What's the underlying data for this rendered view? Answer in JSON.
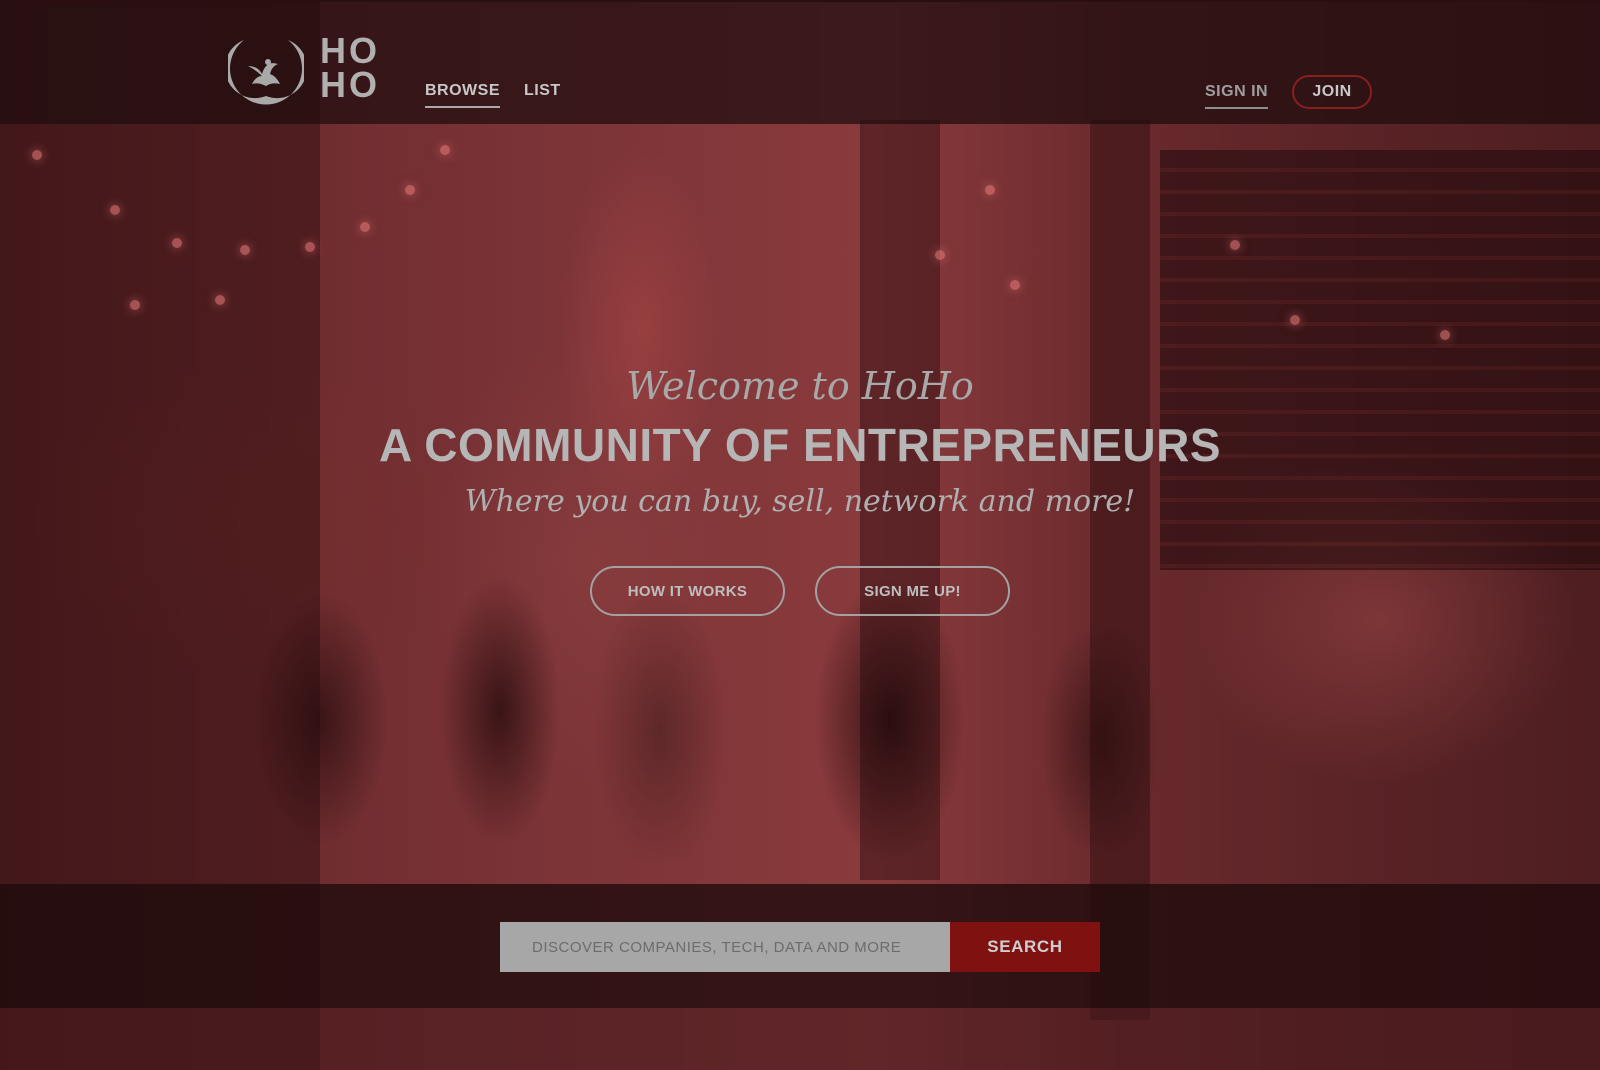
{
  "brand": {
    "logo_line1": "HO",
    "logo_line2": "HO",
    "logo_icon": "phoenix-icon"
  },
  "nav": {
    "items": [
      {
        "label": "BROWSE",
        "active": true
      },
      {
        "label": "LIST",
        "active": false
      }
    ]
  },
  "auth": {
    "signin_label": "SIGN IN",
    "join_label": "JOIN"
  },
  "hero": {
    "welcome": "Welcome to HoHo",
    "headline": "A COMMUNITY OF ENTREPRENEURS",
    "subline": "Where you can buy, sell, network and more!",
    "how_label": "HOW IT WORKS",
    "signup_label": "SIGN ME UP!"
  },
  "search": {
    "placeholder": "DISCOVER COMPANIES, TECH, DATA AND MORE",
    "value": "",
    "button_label": "SEARCH"
  },
  "colors": {
    "overlay": "#5a2326",
    "join_border": "#8a1e1e",
    "search_button": "#7f1111",
    "search_field": "#a7a7a7"
  }
}
